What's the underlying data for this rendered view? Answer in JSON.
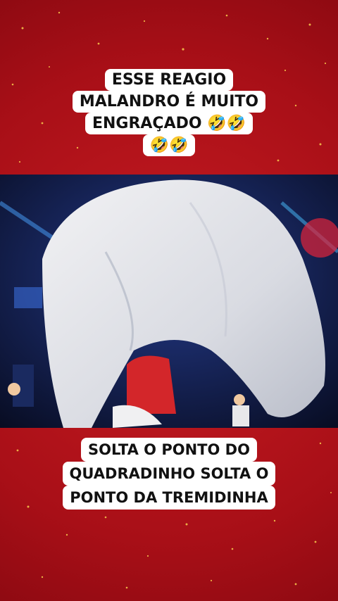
{
  "top_caption": {
    "line1": "ESSE REAGIO",
    "line2": "MALANDRO É MUITO",
    "line3": "ENGRAÇADO 🤣🤣",
    "line4": "🤣🤣"
  },
  "bottom_caption": {
    "line1": "SOLTA O PONTO DO",
    "line2": "QUADRADINHO SOLTA O",
    "line3": "PONTO DA TREMIDINHA"
  },
  "colors": {
    "background": "#b8141c",
    "caption_bg": "#ffffff",
    "caption_text": "#111111"
  }
}
